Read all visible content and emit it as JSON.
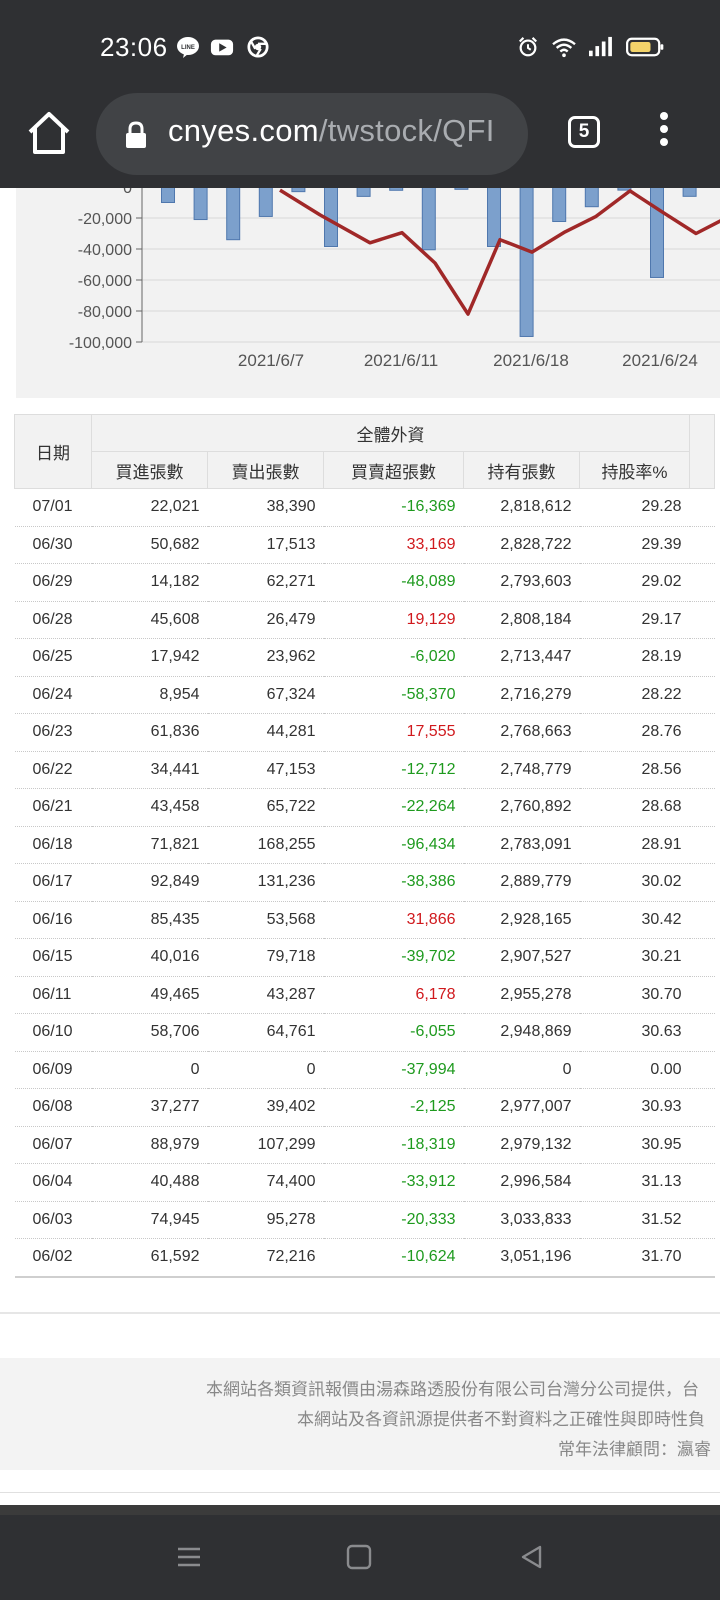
{
  "status_bar": {
    "time": "23:06",
    "left_icons": [
      "line-icon",
      "youtube-icon",
      "chrome-icon"
    ],
    "right_icons": [
      "alarm-icon",
      "wifi-icon",
      "signal-icon",
      "battery-icon"
    ]
  },
  "browser": {
    "url_host": "cnyes.com",
    "url_path": "/twstock/QFI",
    "tab_count": "5"
  },
  "chart_data": {
    "type": "bar+line",
    "y_ticks": [
      "0",
      "-20,000",
      "-40,000",
      "-60,000",
      "-80,000",
      "-100,000"
    ],
    "x_ticks": [
      "2021/6/7",
      "2021/6/11",
      "2021/6/18",
      "2021/6/24"
    ],
    "ylim": [
      -100000,
      0
    ],
    "bars": [
      -10000,
      -21000,
      -34000,
      -19000,
      -3000,
      -38386,
      -6055,
      -2125,
      -40488,
      -1500,
      -38386,
      -96434,
      -22264,
      -12712,
      -2000,
      -58370,
      -6020
    ],
    "line": [
      -2000,
      -18000,
      -36000,
      -29500,
      -49000,
      -82000,
      -34000,
      -42000,
      -29000,
      -19000,
      -2500,
      -16000,
      -30000,
      -20000
    ],
    "bar_color": "#7ca0cc",
    "line_color": "#a02828"
  },
  "table": {
    "group_header": "全體外資",
    "date_header": "日期",
    "headers": [
      "買進張數",
      "賣出張數",
      "買賣超張數",
      "持有張數",
      "持股率%"
    ],
    "rows": [
      {
        "date": "07/01",
        "buy": "22,021",
        "sell": "38,390",
        "net": "-16,369",
        "hold": "2,818,612",
        "pct": "29.28",
        "sign": "neg"
      },
      {
        "date": "06/30",
        "buy": "50,682",
        "sell": "17,513",
        "net": "33,169",
        "hold": "2,828,722",
        "pct": "29.39",
        "sign": "pos"
      },
      {
        "date": "06/29",
        "buy": "14,182",
        "sell": "62,271",
        "net": "-48,089",
        "hold": "2,793,603",
        "pct": "29.02",
        "sign": "neg"
      },
      {
        "date": "06/28",
        "buy": "45,608",
        "sell": "26,479",
        "net": "19,129",
        "hold": "2,808,184",
        "pct": "29.17",
        "sign": "pos"
      },
      {
        "date": "06/25",
        "buy": "17,942",
        "sell": "23,962",
        "net": "-6,020",
        "hold": "2,713,447",
        "pct": "28.19",
        "sign": "neg"
      },
      {
        "date": "06/24",
        "buy": "8,954",
        "sell": "67,324",
        "net": "-58,370",
        "hold": "2,716,279",
        "pct": "28.22",
        "sign": "neg"
      },
      {
        "date": "06/23",
        "buy": "61,836",
        "sell": "44,281",
        "net": "17,555",
        "hold": "2,768,663",
        "pct": "28.76",
        "sign": "pos"
      },
      {
        "date": "06/22",
        "buy": "34,441",
        "sell": "47,153",
        "net": "-12,712",
        "hold": "2,748,779",
        "pct": "28.56",
        "sign": "neg"
      },
      {
        "date": "06/21",
        "buy": "43,458",
        "sell": "65,722",
        "net": "-22,264",
        "hold": "2,760,892",
        "pct": "28.68",
        "sign": "neg"
      },
      {
        "date": "06/18",
        "buy": "71,821",
        "sell": "168,255",
        "net": "-96,434",
        "hold": "2,783,091",
        "pct": "28.91",
        "sign": "neg"
      },
      {
        "date": "06/17",
        "buy": "92,849",
        "sell": "131,236",
        "net": "-38,386",
        "hold": "2,889,779",
        "pct": "30.02",
        "sign": "neg"
      },
      {
        "date": "06/16",
        "buy": "85,435",
        "sell": "53,568",
        "net": "31,866",
        "hold": "2,928,165",
        "pct": "30.42",
        "sign": "pos"
      },
      {
        "date": "06/15",
        "buy": "40,016",
        "sell": "79,718",
        "net": "-39,702",
        "hold": "2,907,527",
        "pct": "30.21",
        "sign": "neg"
      },
      {
        "date": "06/11",
        "buy": "49,465",
        "sell": "43,287",
        "net": "6,178",
        "hold": "2,955,278",
        "pct": "30.70",
        "sign": "pos"
      },
      {
        "date": "06/10",
        "buy": "58,706",
        "sell": "64,761",
        "net": "-6,055",
        "hold": "2,948,869",
        "pct": "30.63",
        "sign": "neg"
      },
      {
        "date": "06/09",
        "buy": "0",
        "sell": "0",
        "net": "-37,994",
        "hold": "0",
        "pct": "0.00",
        "sign": "neg"
      },
      {
        "date": "06/08",
        "buy": "37,277",
        "sell": "39,402",
        "net": "-2,125",
        "hold": "2,977,007",
        "pct": "30.93",
        "sign": "neg"
      },
      {
        "date": "06/07",
        "buy": "88,979",
        "sell": "107,299",
        "net": "-18,319",
        "hold": "2,979,132",
        "pct": "30.95",
        "sign": "neg"
      },
      {
        "date": "06/04",
        "buy": "40,488",
        "sell": "74,400",
        "net": "-33,912",
        "hold": "2,996,584",
        "pct": "31.13",
        "sign": "neg"
      },
      {
        "date": "06/03",
        "buy": "74,945",
        "sell": "95,278",
        "net": "-20,333",
        "hold": "3,033,833",
        "pct": "31.52",
        "sign": "neg"
      },
      {
        "date": "06/02",
        "buy": "61,592",
        "sell": "72,216",
        "net": "-10,624",
        "hold": "3,051,196",
        "pct": "31.70",
        "sign": "neg"
      }
    ]
  },
  "footer": {
    "line1": "本網站各類資訊報價由湯森路透股份有限公司台灣分公司提供，台",
    "line2": "本網站及各資訊源提供者不對資料之正確性與即時性負",
    "line3": "常年法律顧問：瀛睿"
  },
  "colors": {
    "positive": "#d0191d",
    "negative": "#1e9a1e",
    "chrome_dark": "#2f3033"
  }
}
